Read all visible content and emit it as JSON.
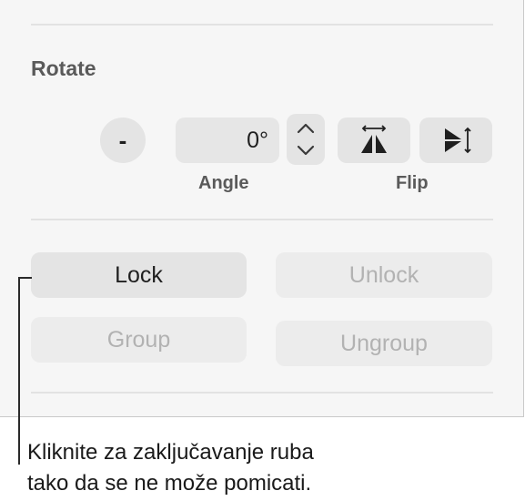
{
  "rotate": {
    "title": "Rotate",
    "minus_label": "-",
    "angle_value": "0°",
    "angle_label": "Angle",
    "flip_label": "Flip"
  },
  "buttons": {
    "lock": "Lock",
    "unlock": "Unlock",
    "group": "Group",
    "ungroup": "Ungroup"
  },
  "callout": {
    "line1": "Kliknite za zaključavanje ruba",
    "line2": "tako da se ne može pomicati."
  },
  "icons": {
    "stepper": "chevron-up-down-icon",
    "flip_horizontal": "flip-horizontal-icon",
    "flip_vertical": "flip-vertical-icon"
  }
}
